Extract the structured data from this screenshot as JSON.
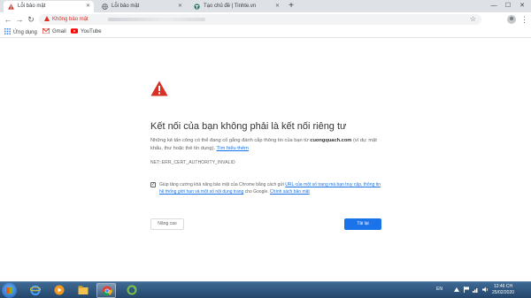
{
  "tabs": [
    {
      "label": "Lỗi bảo mật",
      "active": true,
      "icon": "warning-icon"
    },
    {
      "label": "Lỗi bảo mật",
      "active": false,
      "icon": "globe-icon"
    },
    {
      "label": "Tạo chủ đề | Tinhte.vn",
      "active": false,
      "icon": "tinhte-icon"
    }
  ],
  "toolbar": {
    "security_chip": "Không bảo mật"
  },
  "bookmarks": [
    {
      "label": "Ứng dụng",
      "icon": "apps-grid-icon"
    },
    {
      "label": "Gmail",
      "icon": "gmail-icon"
    },
    {
      "label": "YouTube",
      "icon": "youtube-icon"
    }
  ],
  "interstitial": {
    "headline": "Kết nối của bạn không phải là kết nối riêng tư",
    "desc_prefix": "Những kẻ tấn công có thể đang cố gắng đánh cắp thông tin của bạn từ ",
    "domain": "cuongquach.com",
    "desc_suffix": " (ví dụ: mật khẩu, thư hoặc thẻ tín dụng). ",
    "learn_more": "Tìm hiểu thêm",
    "error_code": "NET::ERR_CERT_AUTHORITY_INVALID",
    "optin_prefix": "Giúp tăng cường khả năng bảo mật của Chrome bằng cách gửi ",
    "optin_link1": "URL của một số trang mà bạn truy cập, thông tin hệ thống giới hạn và một số nội dung trang",
    "optin_middle": " cho Google. ",
    "optin_link2": "Chính sách bảo mật",
    "advanced_button": "Nâng cao",
    "back_button": "Tải lại"
  },
  "taskbar": {
    "language": "EN",
    "time": "12:46 CH",
    "date": "25/02/2020"
  },
  "colors": {
    "accent": "#1a73e8",
    "warning": "#d93025",
    "tabstrip": "#dee1e6",
    "taskbar": "#2f5580"
  }
}
